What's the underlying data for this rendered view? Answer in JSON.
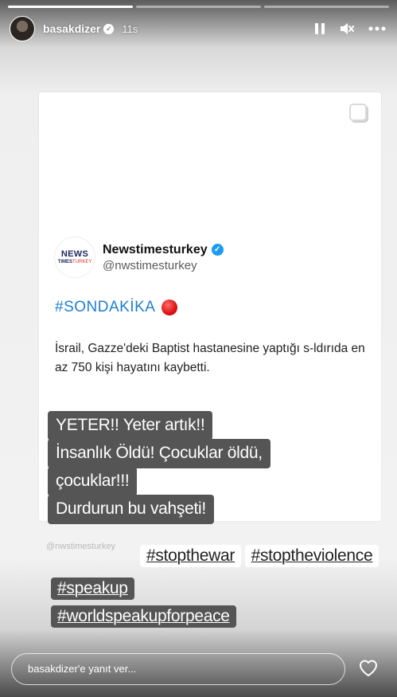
{
  "story": {
    "progress_segments": [
      1,
      0,
      0
    ],
    "username": "basakdizer",
    "time": "11s"
  },
  "tweet": {
    "name": "Newstimesturkey",
    "handle": "@nwstimesturkey",
    "logo_line1": "NEWS",
    "logo_line2a": "TIMES",
    "logo_line2b": "TURKEY",
    "tag": "#SONDAKİKA",
    "body": "İsrail, Gazze'deki Baptist hastanesine yaptığı s-ldırıda en az 750 kişi hayatını kaybetti."
  },
  "overlay": {
    "lines": [
      "YETER!! Yeter artık!!",
      "İnsanlık Öldü! Çocuklar öldü,",
      "çocuklar!!!",
      "Durdurun bu vahşeti!"
    ],
    "hashtags_row1": [
      "#stopthewar",
      "#stoptheviolence"
    ],
    "hashtags_row2": [
      "#speakup"
    ],
    "hashtags_row3": [
      "#worldspeakupforpeace"
    ],
    "faint_text": "@nwstimesturkey"
  },
  "reply": {
    "placeholder": "basakdizer'e yanıt ver..."
  },
  "colors": {
    "tweet_tag": "#1d7fd0",
    "verified": "#1d9bf0",
    "overlay_bg": "#555555"
  },
  "icons": [
    "pause-icon",
    "mute-icon",
    "more-icon",
    "heart-icon",
    "verified-badge-icon"
  ]
}
